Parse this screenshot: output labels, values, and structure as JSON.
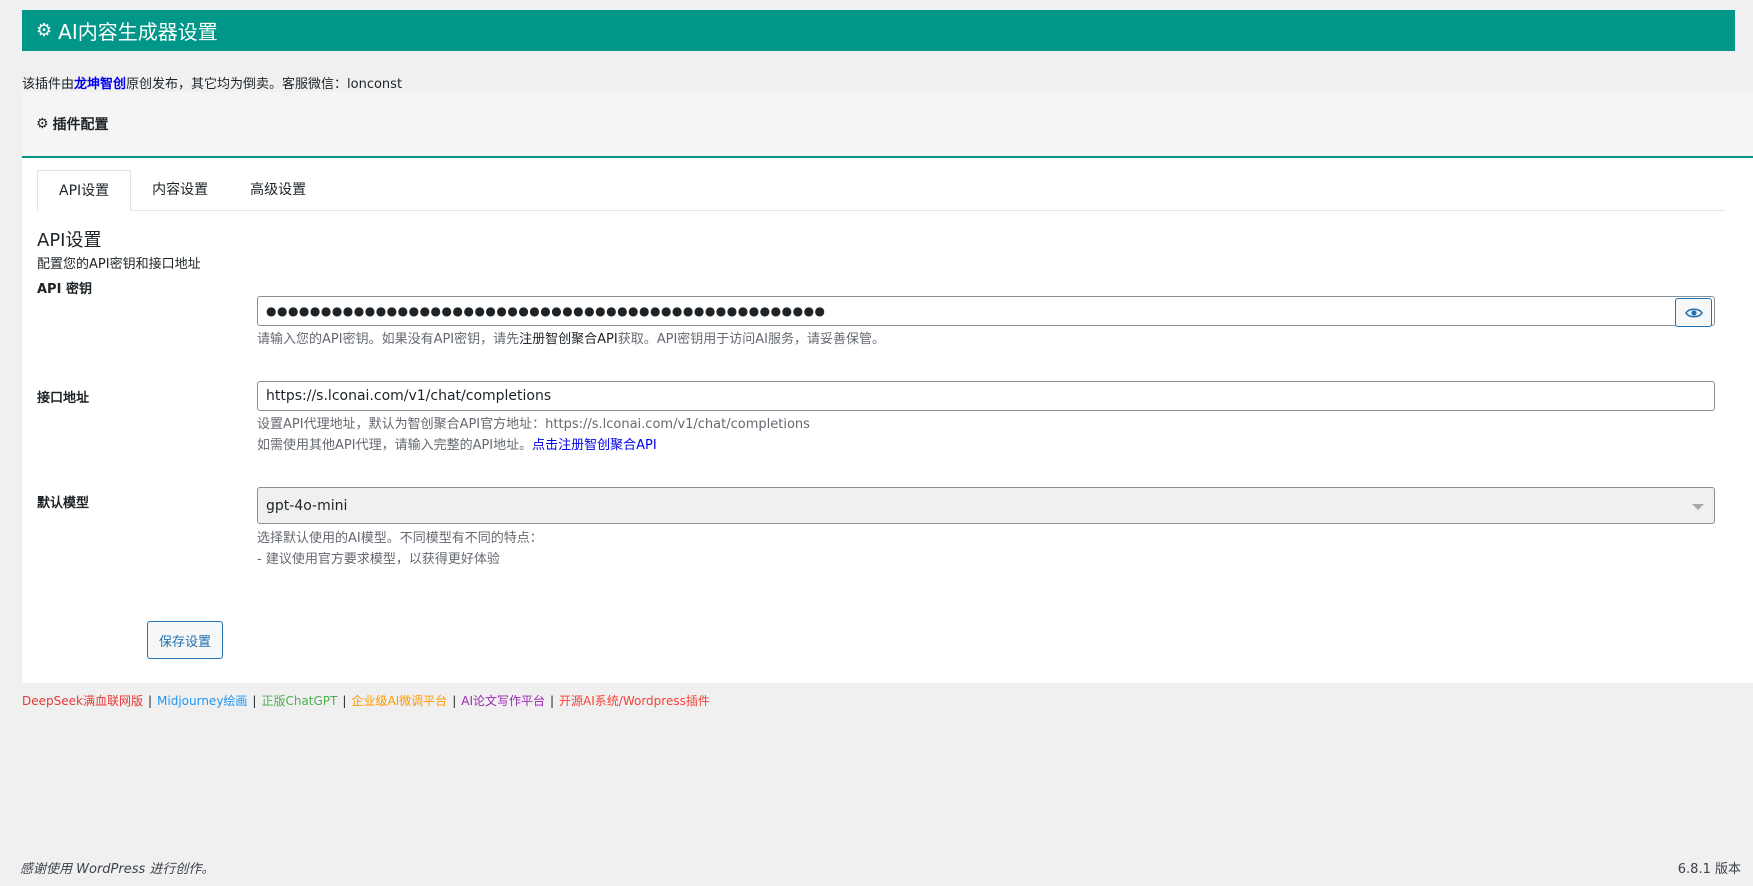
{
  "header": {
    "title": "AI内容生成器设置",
    "icon": "gear-icon"
  },
  "notice": {
    "prefix": "该插件由",
    "author": "龙坤智创",
    "suffix": "原创发布，其它均为倒卖。客服微信：lonconst"
  },
  "panel": {
    "title": "插件配置",
    "icon": "gear-icon"
  },
  "tabs": [
    {
      "label": "API设置",
      "active": true
    },
    {
      "label": "内容设置",
      "active": false
    },
    {
      "label": "高级设置",
      "active": false
    }
  ],
  "section": {
    "title": "API设置",
    "desc": "配置您的API密钥和接口地址"
  },
  "api_key": {
    "label": "API 密钥",
    "value": "●●●●●●●●●●●●●●●●●●●●●●●●●●●●●●●●●●●●●●●●●●●●●●●●●●●",
    "help_a": "请输入您的API密钥。如果没有API密钥，请先",
    "help_link": "注册智创聚合API",
    "help_b": "获取。API密钥用于访问AI服务，请妥善保管。"
  },
  "endpoint": {
    "label": "接口地址",
    "value": "https://s.lconai.com/v1/chat/completions",
    "help_1": "设置API代理地址，默认为智创聚合API官方地址：https://s.lconai.com/v1/chat/completions",
    "help_2": "如需使用其他API代理，请输入完整的API地址。",
    "help_link": "点击注册智创聚合API"
  },
  "model": {
    "label": "默认模型",
    "value": "gpt-4o-mini",
    "help_1": "选择默认使用的AI模型。不同模型有不同的特点：",
    "help_2": "- 建议使用官方要求模型，以获得更好体验"
  },
  "save_label": "保存设置",
  "footer_links": [
    {
      "label": "DeepSeek满血联网版",
      "color": "#e53935"
    },
    {
      "label": "Midjourney绘画",
      "color": "#2196f3"
    },
    {
      "label": "正版ChatGPT",
      "color": "#4caf50"
    },
    {
      "label": "企业级AI微调平台",
      "color": "#ff9800"
    },
    {
      "label": "AI论文写作平台",
      "color": "#9c27b0"
    },
    {
      "label": "开源AI系统/Wordpress插件",
      "color": "#f44336"
    }
  ],
  "wp_footer": "感谢使用 WordPress 进行创作。",
  "version": "6.8.1 版本"
}
